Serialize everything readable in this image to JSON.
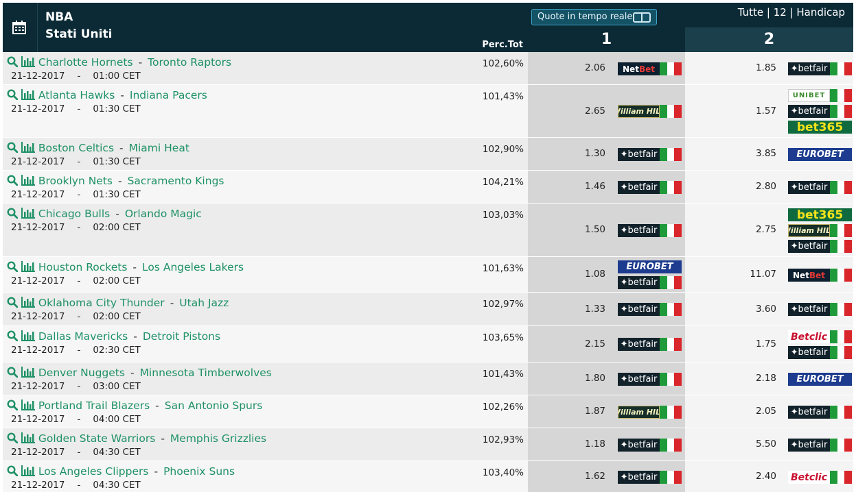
{
  "header": {
    "league": "NBA",
    "country": "Stati Uniti",
    "perc_label": "Perc.Tot",
    "realtime_label": "Quote in tempo reale",
    "filters": "Tutte | 12 | Handicap",
    "col1": "1",
    "col2": "2"
  },
  "bookmakers": {
    "betfair": "betfair",
    "netbet_a": "Net",
    "netbet_b": "Bet",
    "williamhill": "William HILL",
    "unibet": "UNIBET",
    "bet365": "bet365",
    "eurobet": "EUROBET",
    "betclic": "Betclic"
  },
  "colors": {
    "header_bg": "#0b2a36",
    "team_link": "#1e9166",
    "odds_col1_bg": "#d6d6d6"
  },
  "matches": [
    {
      "home": "Charlotte Hornets",
      "away": "Toronto Raptors",
      "date": "21-12-2017",
      "sep": "-",
      "time": "01:00 CET",
      "perc": "102,60%",
      "odd1": "2.06",
      "odd2": "1.85"
    },
    {
      "home": "Atlanta Hawks",
      "away": "Indiana Pacers",
      "date": "21-12-2017",
      "sep": "-",
      "time": "01:30 CET",
      "perc": "101,43%",
      "odd1": "2.65",
      "odd2": "1.57"
    },
    {
      "home": "Boston Celtics",
      "away": "Miami Heat",
      "date": "21-12-2017",
      "sep": "-",
      "time": "01:30 CET",
      "perc": "102,90%",
      "odd1": "1.30",
      "odd2": "3.85"
    },
    {
      "home": "Brooklyn Nets",
      "away": "Sacramento Kings",
      "date": "21-12-2017",
      "sep": "-",
      "time": "01:30 CET",
      "perc": "104,21%",
      "odd1": "1.46",
      "odd2": "2.80"
    },
    {
      "home": "Chicago Bulls",
      "away": "Orlando Magic",
      "date": "21-12-2017",
      "sep": "-",
      "time": "02:00 CET",
      "perc": "103,03%",
      "odd1": "1.50",
      "odd2": "2.75"
    },
    {
      "home": "Houston Rockets",
      "away": "Los Angeles Lakers",
      "date": "21-12-2017",
      "sep": "-",
      "time": "02:00 CET",
      "perc": "101,63%",
      "odd1": "1.08",
      "odd2": "11.07"
    },
    {
      "home": "Oklahoma City Thunder",
      "away": "Utah Jazz",
      "date": "21-12-2017",
      "sep": "-",
      "time": "02:00 CET",
      "perc": "102,97%",
      "odd1": "1.33",
      "odd2": "3.60"
    },
    {
      "home": "Dallas Mavericks",
      "away": "Detroit Pistons",
      "date": "21-12-2017",
      "sep": "-",
      "time": "02:30 CET",
      "perc": "103,65%",
      "odd1": "2.15",
      "odd2": "1.75"
    },
    {
      "home": "Denver Nuggets",
      "away": "Minnesota Timberwolves",
      "date": "21-12-2017",
      "sep": "-",
      "time": "03:00 CET",
      "perc": "101,43%",
      "odd1": "1.80",
      "odd2": "2.18"
    },
    {
      "home": "Portland Trail Blazers",
      "away": "San Antonio Spurs",
      "date": "21-12-2017",
      "sep": "-",
      "time": "04:00 CET",
      "perc": "102,26%",
      "odd1": "1.87",
      "odd2": "2.05"
    },
    {
      "home": "Golden State Warriors",
      "away": "Memphis Grizzlies",
      "date": "21-12-2017",
      "sep": "-",
      "time": "04:30 CET",
      "perc": "102,93%",
      "odd1": "1.18",
      "odd2": "5.50"
    },
    {
      "home": "Los Angeles Clippers",
      "away": "Phoenix Suns",
      "date": "21-12-2017",
      "sep": "-",
      "time": "04:30 CET",
      "perc": "103,40%",
      "odd1": "1.62",
      "odd2": "2.40"
    }
  ]
}
